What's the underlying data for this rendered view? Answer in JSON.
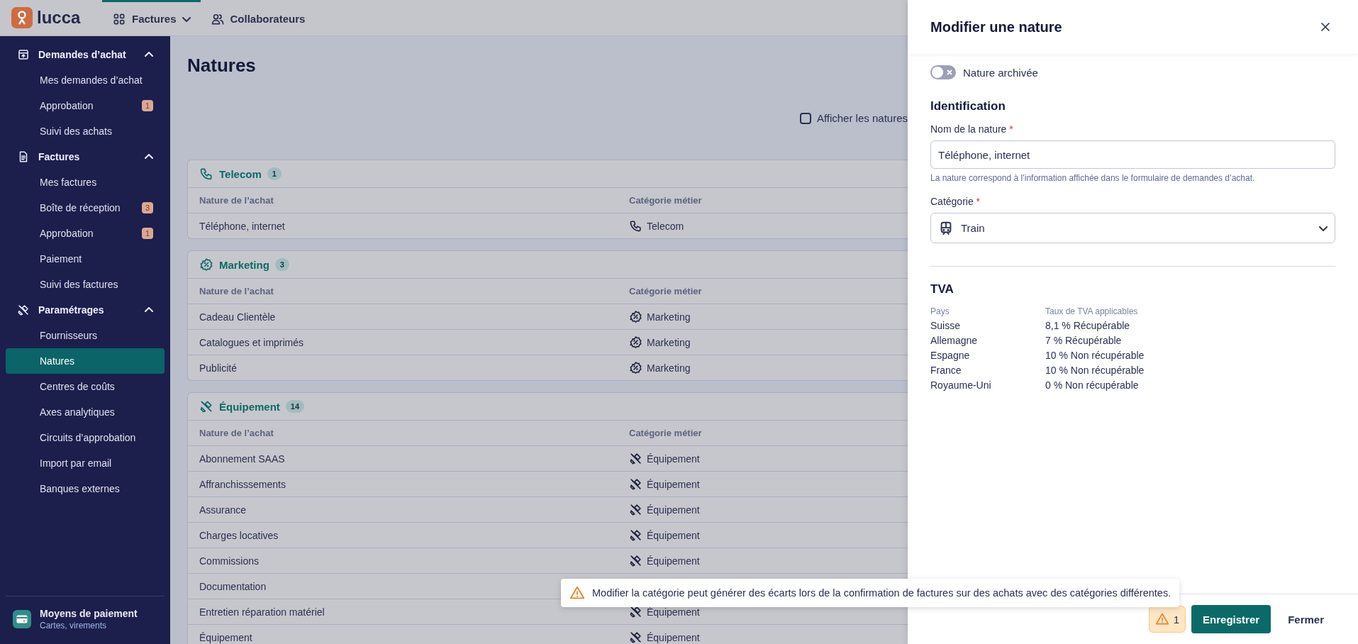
{
  "app": {
    "logo": "lucca",
    "nav": [
      {
        "label": "Factures",
        "dropdown": true,
        "selected": true
      },
      {
        "label": "Collaborateurs",
        "dropdown": false,
        "selected": false
      }
    ]
  },
  "sidebar": {
    "sections": [
      {
        "title": "Demandes d’achat",
        "expanded": true,
        "items": [
          {
            "label": "Mes demandes d’achat",
            "selected": false
          },
          {
            "label": "Approbation",
            "badge": "1",
            "selected": false
          },
          {
            "label": "Suivi des achats",
            "selected": false
          }
        ]
      },
      {
        "title": "Factures",
        "expanded": true,
        "items": [
          {
            "label": "Mes factures",
            "selected": false
          },
          {
            "label": "Boîte de réception",
            "badge": "3",
            "selected": false
          },
          {
            "label": "Approbation",
            "badge": "1",
            "selected": false
          },
          {
            "label": "Paiement",
            "selected": false
          },
          {
            "label": "Suivi des factures",
            "selected": false
          }
        ]
      },
      {
        "title": "Paramétrages",
        "expanded": true,
        "items": [
          {
            "label": "Fournisseurs",
            "selected": false
          },
          {
            "label": "Natures",
            "selected": true
          },
          {
            "label": "Centres de coûts",
            "selected": false
          },
          {
            "label": "Axes analytiques",
            "selected": false
          },
          {
            "label": "Circuits d’approbation",
            "selected": false
          },
          {
            "label": "Import par email",
            "selected": false
          },
          {
            "label": "Banques externes",
            "selected": false
          }
        ]
      }
    ],
    "footer": {
      "title": "Moyens de paiement",
      "subtitle": "Cartes, virements"
    }
  },
  "page": {
    "title": "Natures",
    "archived_filter": {
      "label": "Afficher les natures",
      "checked": false
    },
    "groups": [
      {
        "name": "Telecom",
        "kind": "phone",
        "count": "1",
        "columns": [
          "Nature de l’achat",
          "Catégorie métier"
        ],
        "rows": [
          {
            "nature": "Téléphone, internet",
            "category": "Telecom"
          }
        ]
      },
      {
        "name": "Marketing",
        "kind": "percent",
        "count": "3",
        "columns": [
          "Nature de l’achat",
          "Catégorie métier"
        ],
        "rows": [
          {
            "nature": "Cadeau Clientèle",
            "category": "Marketing"
          },
          {
            "nature": "Catalogues et imprimés",
            "category": "Marketing"
          },
          {
            "nature": "Publicité",
            "category": "Marketing"
          }
        ]
      },
      {
        "name": "Équipement",
        "kind": "tools",
        "count": "14",
        "columns": [
          "Nature de l’achat",
          "Catégorie métier"
        ],
        "rows": [
          {
            "nature": "Abonnement SAAS",
            "category": "Équipement"
          },
          {
            "nature": "Affranchisssements",
            "category": "Équipement"
          },
          {
            "nature": "Assurance",
            "category": "Équipement"
          },
          {
            "nature": "Charges locatives",
            "category": "Équipement"
          },
          {
            "nature": "Commissions",
            "category": "Équipement"
          },
          {
            "nature": "Documentation"
          },
          {
            "nature": "Entretien réparation matériel",
            "category": "Équipement"
          },
          {
            "nature": "Équipement",
            "category": "Équipement"
          }
        ]
      }
    ]
  },
  "toast": {
    "message": "Modifier la catégorie peut générer des écarts lors de la confirmation de factures sur des achats avec des catégories différentes."
  },
  "panel": {
    "title": "Modifier une nature",
    "archived_toggle": {
      "label": "Nature archivée",
      "on": false
    },
    "identification": {
      "title": "Identification",
      "name_field": {
        "label": "Nom de la nature",
        "required_mark": "*",
        "value": "Téléphone, internet",
        "hint": "La nature correspond à l’information affichée dans le formulaire de demandes d’achat."
      },
      "category_field": {
        "label": "Catégorie",
        "required_mark": "*",
        "value": "Train",
        "kind": "train"
      }
    },
    "vat": {
      "title": "TVA",
      "columns": [
        "Pays",
        "Taux de TVA applicables"
      ],
      "rows": [
        {
          "country": "Suisse",
          "rate": "8,1 % Récupérable"
        },
        {
          "country": "Allemagne",
          "rate": "7 % Récupérable"
        },
        {
          "country": "Espagne",
          "rate": "10 % Non récupérable"
        },
        {
          "country": "France",
          "rate": "10 % Non récupérable"
        },
        {
          "country": "Royaume-Uni",
          "rate": "0 % Non récupérable"
        }
      ]
    },
    "footer": {
      "warning_count": "1",
      "save": "Enregistrer",
      "close": "Fermer"
    }
  }
}
